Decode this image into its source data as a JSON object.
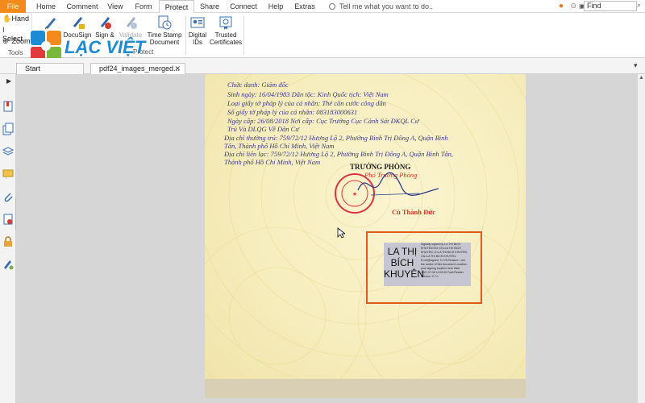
{
  "menu": {
    "file": "File",
    "tabs": [
      "Home",
      "Comment",
      "View",
      "Form",
      "Protect",
      "Share",
      "Connect",
      "Help",
      "Extras"
    ],
    "active_tab": "Protect",
    "tell_me": "Tell me what you want to do..",
    "find_value": "Find"
  },
  "tools": {
    "hand": "Hand",
    "select": "Select",
    "zoom": "Zoom",
    "group_label": "Tools"
  },
  "protect": {
    "buttons": [
      "DocuSign",
      "Sign &",
      "Validate",
      "Time Stamp Document",
      "Digital IDs",
      "Trusted Certificates"
    ],
    "group_label": "Protect"
  },
  "logo": {
    "text": "LẠC VIỆT"
  },
  "doc_tabs": [
    "Start",
    "pdf24_images_merged..."
  ],
  "document": {
    "lines": [
      "Chức danh: Giám đốc",
      "Sinh ngày: 16/04/1983     Dân tộc: Kinh          Quốc tịch: Việt Nam",
      "Loại giấy tờ pháp lý của cá nhân:   Thẻ căn cước công dân",
      "Số giấy tờ pháp lý của cá nhân: 083183000631",
      "Ngày cấp:  26/08/2018          Nơi cấp:  Cục Trưởng Cục Cảnh Sát ĐKQL Cư",
      "                                          Trú Và DLQG Về Dân Cư",
      "Địa chỉ thường trú: 759/72/12 Hương Lộ 2, Phường Bình Trị Đông A, Quận Bình",
      "Tân, Thành phố Hồ Chí Minh, Việt Nam",
      "Địa chỉ liên lạc: 759/72/12 Hương Lộ 2, Phường Bình Trị Đông A, Quận Bình Tân,",
      "Thành phố Hồ Chí Minh, Việt Nam"
    ],
    "title": "TRƯỞNG PHÒNG",
    "subtitle": "Phó Trưởng Phòng",
    "signer": "Cù Thành Đức"
  },
  "signature": {
    "name": "LA THỊ BÍCH KHUYÊN",
    "details": "Digitally signed by LA THI BICH KHUYEN DN: CN=LA THI BICH KHUYEN, O=LA THI BICH KHUYEN, OU=LA THI BICH KHUYEN, E=vk@signed, C=VN Reason: I am the author of this document Location: your signing location here Date: 2021.07.08 11:09:30 Foxit Reader Version: 9.7.0"
  }
}
